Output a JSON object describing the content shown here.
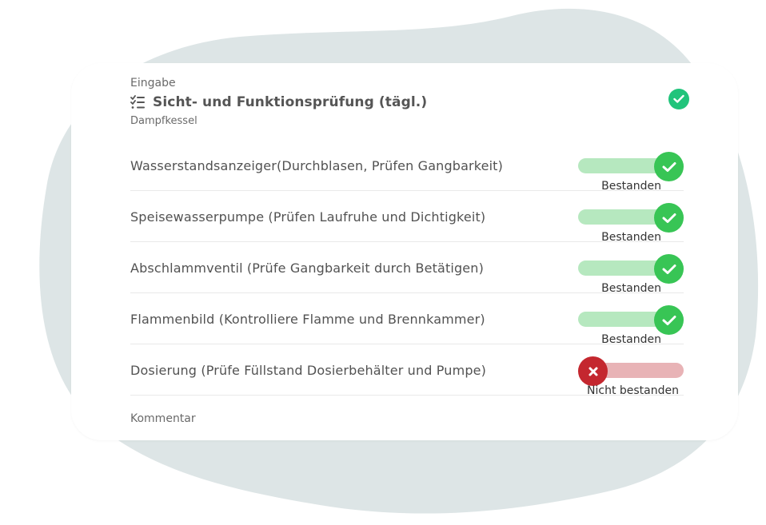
{
  "form": {
    "eyebrow": "Eingabe",
    "title": "Sicht- und Funktionsprüfung (tägl.)",
    "subtitle": "Dampfkessel",
    "comment_label": "Kommentar"
  },
  "colors": {
    "pass_knob": "#38c555",
    "pass_track": "#b6e8bf",
    "fail_knob": "#c4272f",
    "fail_track": "#e8b3b6",
    "status_check": "#21c47b",
    "blob": "#dde5e6"
  },
  "items": [
    {
      "label": "Wasserstandsanzeiger(Durchblasen, Prüfen Gangbarkeit)",
      "status": "pass",
      "status_label": "Bestanden",
      "icon": "check-icon"
    },
    {
      "label": "Speisewasserpumpe (Prüfen Laufruhe und Dichtigkeit)",
      "status": "pass",
      "status_label": "Bestanden",
      "icon": "check-icon"
    },
    {
      "label": "Abschlammventil (Prüfe Gangbarkeit durch Betätigen)",
      "status": "pass",
      "status_label": "Bestanden",
      "icon": "check-icon"
    },
    {
      "label": "Flammenbild (Kontrolliere Flamme und Brennkammer)",
      "status": "pass",
      "status_label": "Bestanden",
      "icon": "check-icon"
    },
    {
      "label": "Dosierung (Prüfe Füllstand Dosierbehälter und Pumpe)",
      "status": "fail",
      "status_label": "Nicht bestanden",
      "icon": "x-icon"
    }
  ]
}
